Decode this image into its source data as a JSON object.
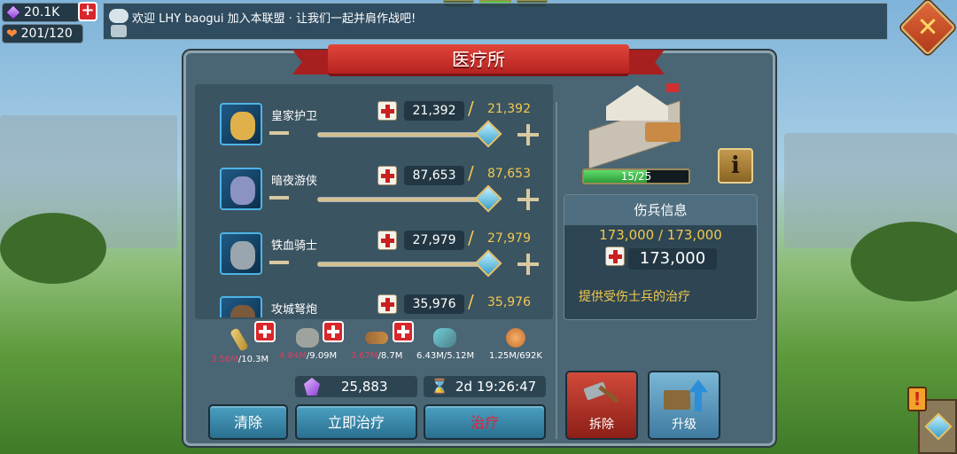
{
  "resources": {
    "gems": "20.1K",
    "stamina": "201/120"
  },
  "chat": {
    "message": "欢迎 LHY  baogui 加入本联盟 · 让我们一起并肩作战吧!"
  },
  "dialog": {
    "title": "医疗所"
  },
  "troops": [
    {
      "name": "皇家护卫",
      "heal_count": "21,392",
      "max": "21,392",
      "slider_fraction": 1.0
    },
    {
      "name": "暗夜游侠",
      "heal_count": "87,653",
      "max": "87,653",
      "slider_fraction": 1.0
    },
    {
      "name": "铁血骑士",
      "heal_count": "27,979",
      "max": "27,979",
      "slider_fraction": 1.0
    },
    {
      "name": "攻城弩炮",
      "heal_count": "35,976",
      "max": "35,976",
      "slider_fraction": 1.0
    }
  ],
  "costs": {
    "food": {
      "need": "3.56M",
      "have": "/10.3M"
    },
    "stone": {
      "need": "4.84M",
      "have": "/9.09M"
    },
    "wood": {
      "need": "3.67M",
      "have": "/8.7M"
    },
    "ore": {
      "text": "6.43M/5.12M"
    },
    "gold": {
      "text": "1.25M/692K"
    }
  },
  "instant_cost": {
    "gems": "25,883",
    "time": "2d 19:26:47"
  },
  "buttons": {
    "clear": "清除",
    "instant_heal": "立即治疗",
    "heal": "治疗",
    "demolish": "拆除",
    "upgrade": "升级",
    "info": "i"
  },
  "building": {
    "level_progress": "15/25",
    "progress_fraction": 0.6
  },
  "wounded": {
    "header": "伤兵信息",
    "ratio": "173,000 / 173,000",
    "total": "173,000",
    "description": "提供受伤士兵的治疗"
  },
  "colors": {
    "panel": "#4a6574",
    "gold_text": "#f2c94c",
    "red_banner": "#b52320",
    "heal_text": "#e0233a"
  }
}
